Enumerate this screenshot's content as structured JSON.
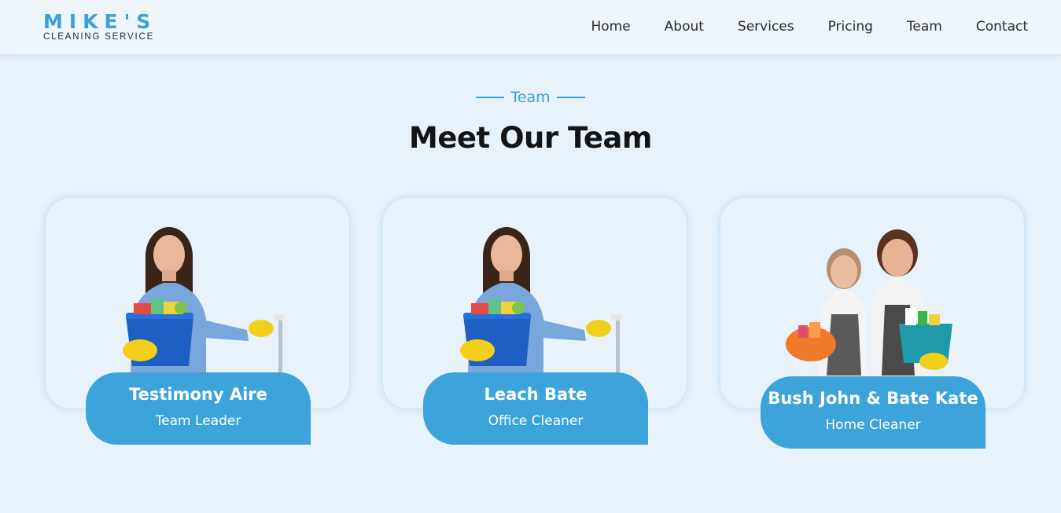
{
  "header": {
    "logo_main": "MIKE'S",
    "logo_sub": "CLEANING SERVICE",
    "nav": [
      "Home",
      "About",
      "Services",
      "Pricing",
      "Team",
      "Contact"
    ]
  },
  "section": {
    "tag": "Team",
    "title": "Meet Our Team"
  },
  "team": [
    {
      "name": "Testimony Aire",
      "role": "Team Leader",
      "photo": "woman-with-cleaning-bucket-and-mop"
    },
    {
      "name": "Leach Bate",
      "role": "Office Cleaner",
      "photo": "woman-with-cleaning-bucket-and-mop"
    },
    {
      "name": "Bush John & Bate Kate",
      "role": "Home Cleaner",
      "photo": "couple-with-cleaning-supplies"
    }
  ],
  "colors": {
    "accent": "#3ba0d9",
    "page_bg": "#e8f2fa",
    "card_label_bg": "#3ca3db"
  }
}
